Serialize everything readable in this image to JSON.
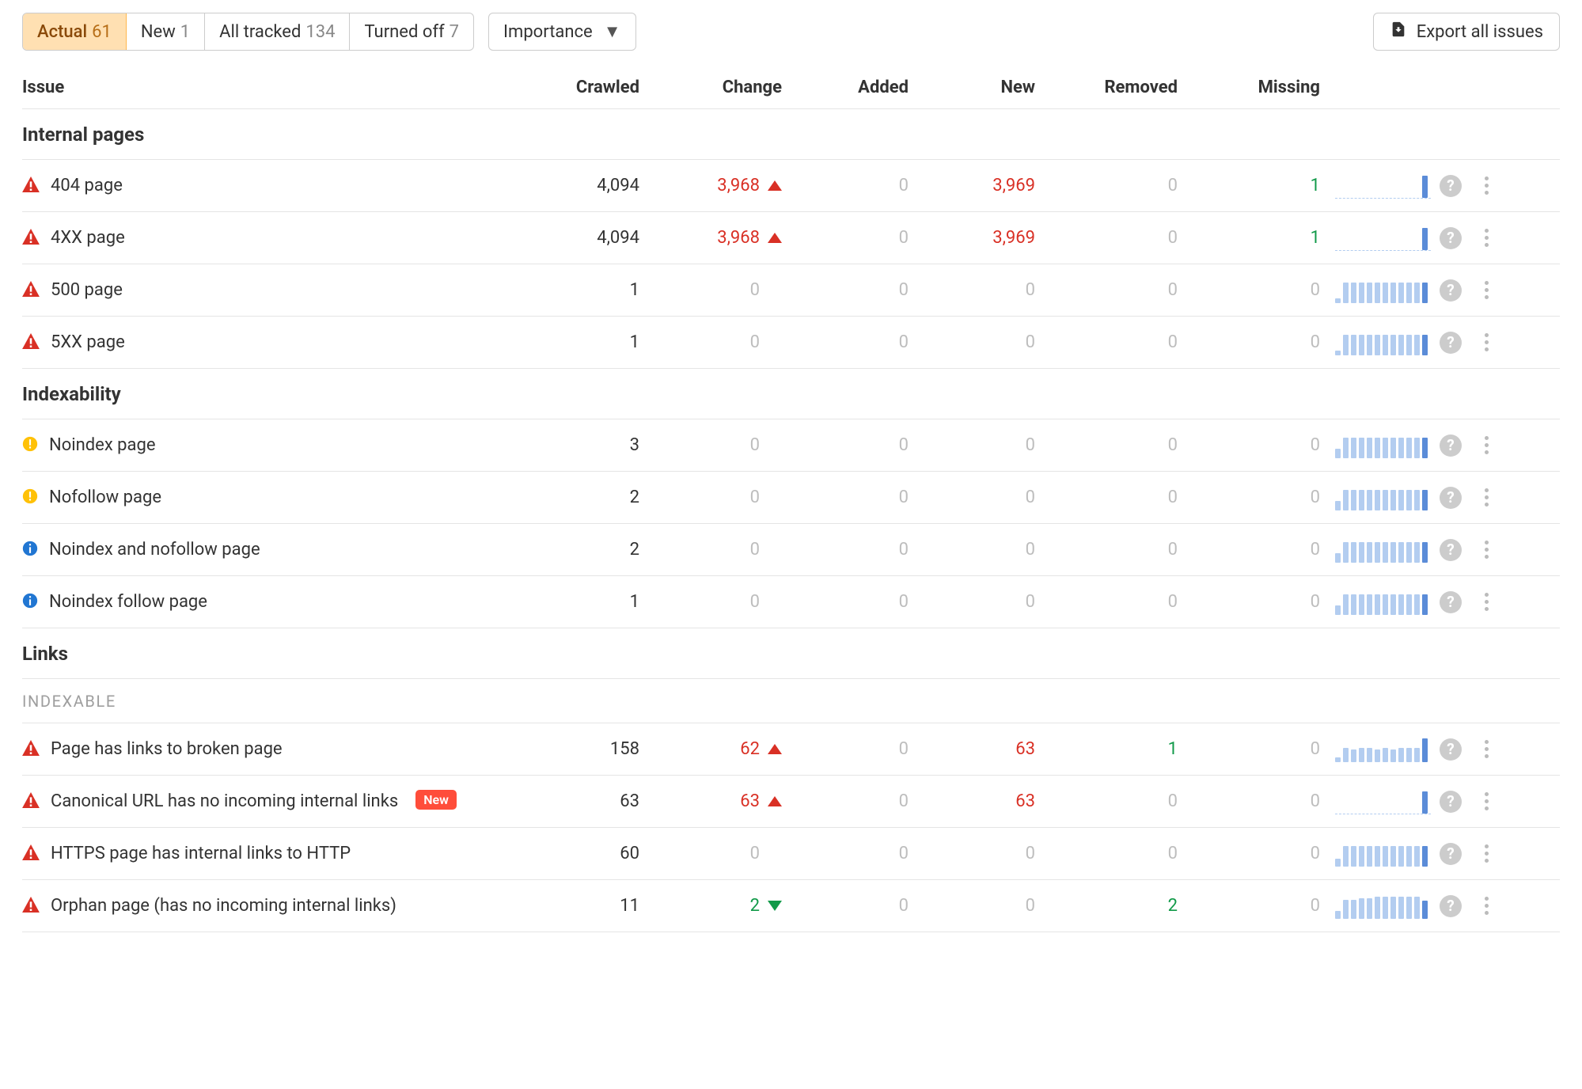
{
  "tabs": [
    {
      "label": "Actual",
      "count": "61",
      "active": true
    },
    {
      "label": "New",
      "count": "1",
      "active": false
    },
    {
      "label": "All tracked",
      "count": "134",
      "active": false
    },
    {
      "label": "Turned off",
      "count": "7",
      "active": false
    }
  ],
  "dropdown_label": "Importance",
  "export_label": "Export all issues",
  "columns": {
    "issue": "Issue",
    "crawled": "Crawled",
    "change": "Change",
    "added": "Added",
    "new": "New",
    "removed": "Removed",
    "missing": "Missing"
  },
  "sections": [
    {
      "title": "Internal pages",
      "rows": [
        {
          "sev": "error",
          "name": "404 page",
          "crawled": "4,094",
          "change_val": "3,968",
          "change_dir": "up",
          "added": "0",
          "added_muted": true,
          "new": "3,969",
          "new_color": "red",
          "removed": "0",
          "removed_muted": true,
          "missing": "1",
          "missing_color": "green",
          "bars": [
            0,
            0,
            0,
            0,
            0,
            0,
            0,
            0,
            0,
            0,
            0,
            28
          ],
          "dashed": true
        },
        {
          "sev": "error",
          "name": "4XX page",
          "crawled": "4,094",
          "change_val": "3,968",
          "change_dir": "up",
          "added": "0",
          "added_muted": true,
          "new": "3,969",
          "new_color": "red",
          "removed": "0",
          "removed_muted": true,
          "missing": "1",
          "missing_color": "green",
          "bars": [
            0,
            0,
            0,
            0,
            0,
            0,
            0,
            0,
            0,
            0,
            0,
            28
          ],
          "dashed": true
        },
        {
          "sev": "error",
          "name": "500 page",
          "crawled": "1",
          "change_val": "0",
          "change_dir": "none",
          "added": "0",
          "added_muted": true,
          "new": "0",
          "new_muted": true,
          "removed": "0",
          "removed_muted": true,
          "missing": "0",
          "missing_muted": true,
          "bars": [
            6,
            26,
            26,
            26,
            26,
            26,
            26,
            26,
            26,
            26,
            26,
            26
          ],
          "dashed": false
        },
        {
          "sev": "error",
          "name": "5XX page",
          "crawled": "1",
          "change_val": "0",
          "change_dir": "none",
          "added": "0",
          "added_muted": true,
          "new": "0",
          "new_muted": true,
          "removed": "0",
          "removed_muted": true,
          "missing": "0",
          "missing_muted": true,
          "bars": [
            6,
            26,
            26,
            26,
            26,
            26,
            26,
            26,
            26,
            26,
            26,
            26
          ],
          "dashed": false
        }
      ]
    },
    {
      "title": "Indexability",
      "rows": [
        {
          "sev": "warning",
          "name": "Noindex page",
          "crawled": "3",
          "change_val": "0",
          "change_dir": "none",
          "added": "0",
          "added_muted": true,
          "new": "0",
          "new_muted": true,
          "removed": "0",
          "removed_muted": true,
          "missing": "0",
          "missing_muted": true,
          "bars": [
            12,
            26,
            26,
            26,
            26,
            26,
            26,
            26,
            26,
            26,
            26,
            26
          ],
          "dashed": false
        },
        {
          "sev": "warning",
          "name": "Nofollow page",
          "crawled": "2",
          "change_val": "0",
          "change_dir": "none",
          "added": "0",
          "added_muted": true,
          "new": "0",
          "new_muted": true,
          "removed": "0",
          "removed_muted": true,
          "missing": "0",
          "missing_muted": true,
          "bars": [
            12,
            26,
            26,
            26,
            26,
            26,
            26,
            26,
            26,
            26,
            26,
            26
          ],
          "dashed": false
        },
        {
          "sev": "info",
          "name": "Noindex and nofollow page",
          "crawled": "2",
          "change_val": "0",
          "change_dir": "none",
          "added": "0",
          "added_muted": true,
          "new": "0",
          "new_muted": true,
          "removed": "0",
          "removed_muted": true,
          "missing": "0",
          "missing_muted": true,
          "bars": [
            12,
            26,
            26,
            26,
            26,
            26,
            26,
            26,
            26,
            26,
            26,
            26
          ],
          "dashed": false
        },
        {
          "sev": "info",
          "name": "Noindex follow page",
          "crawled": "1",
          "change_val": "0",
          "change_dir": "none",
          "added": "0",
          "added_muted": true,
          "new": "0",
          "new_muted": true,
          "removed": "0",
          "removed_muted": true,
          "missing": "0",
          "missing_muted": true,
          "bars": [
            12,
            26,
            26,
            26,
            26,
            26,
            26,
            26,
            26,
            26,
            26,
            26
          ],
          "dashed": false
        }
      ]
    },
    {
      "title": "Links",
      "subtitle": "Indexable",
      "rows": [
        {
          "sev": "error",
          "name": "Page has links to broken page",
          "crawled": "158",
          "change_val": "62",
          "change_dir": "up",
          "added": "0",
          "added_muted": true,
          "new": "63",
          "new_color": "red",
          "removed": "1",
          "removed_color": "green",
          "missing": "0",
          "missing_muted": true,
          "bars": [
            6,
            18,
            16,
            18,
            18,
            16,
            18,
            16,
            18,
            18,
            18,
            30
          ],
          "dashed": false
        },
        {
          "sev": "error",
          "name": "Canonical URL has no incoming internal links",
          "badge": "New",
          "crawled": "63",
          "change_val": "63",
          "change_dir": "up",
          "added": "0",
          "added_muted": true,
          "new": "63",
          "new_color": "red",
          "removed": "0",
          "removed_muted": true,
          "missing": "0",
          "missing_muted": true,
          "bars": [
            0,
            0,
            0,
            0,
            0,
            0,
            0,
            0,
            0,
            0,
            0,
            28
          ],
          "dashed": true
        },
        {
          "sev": "error",
          "name": "HTTPS page has internal links to HTTP",
          "crawled": "60",
          "change_val": "0",
          "change_dir": "none",
          "added": "0",
          "added_muted": true,
          "new": "0",
          "new_muted": true,
          "removed": "0",
          "removed_muted": true,
          "missing": "0",
          "missing_muted": true,
          "bars": [
            10,
            26,
            26,
            26,
            26,
            26,
            26,
            26,
            26,
            26,
            26,
            26
          ],
          "dashed": false
        },
        {
          "sev": "error",
          "name": "Orphan page (has no incoming internal links)",
          "crawled": "11",
          "change_val": "2",
          "change_dir": "down",
          "added": "0",
          "added_muted": true,
          "new": "0",
          "new_muted": true,
          "removed": "2",
          "removed_color": "green",
          "missing": "0",
          "missing_muted": true,
          "bars": [
            10,
            24,
            24,
            26,
            26,
            28,
            28,
            28,
            28,
            28,
            28,
            23
          ],
          "dashed": false
        }
      ]
    }
  ],
  "chart_data": {
    "type": "table",
    "title": "Site Audit — All Issues",
    "columns": [
      "Issue",
      "Crawled",
      "Change",
      "Added",
      "New",
      "Removed",
      "Missing"
    ],
    "groups": [
      {
        "name": "Internal pages",
        "rows": [
          {
            "issue": "404 page",
            "crawled": 4094,
            "change": 3968,
            "added": 0,
            "new": 3969,
            "removed": 0,
            "missing": 1
          },
          {
            "issue": "4XX page",
            "crawled": 4094,
            "change": 3968,
            "added": 0,
            "new": 3969,
            "removed": 0,
            "missing": 1
          },
          {
            "issue": "500 page",
            "crawled": 1,
            "change": 0,
            "added": 0,
            "new": 0,
            "removed": 0,
            "missing": 0
          },
          {
            "issue": "5XX page",
            "crawled": 1,
            "change": 0,
            "added": 0,
            "new": 0,
            "removed": 0,
            "missing": 0
          }
        ]
      },
      {
        "name": "Indexability",
        "rows": [
          {
            "issue": "Noindex page",
            "crawled": 3,
            "change": 0,
            "added": 0,
            "new": 0,
            "removed": 0,
            "missing": 0
          },
          {
            "issue": "Nofollow page",
            "crawled": 2,
            "change": 0,
            "added": 0,
            "new": 0,
            "removed": 0,
            "missing": 0
          },
          {
            "issue": "Noindex and nofollow page",
            "crawled": 2,
            "change": 0,
            "added": 0,
            "new": 0,
            "removed": 0,
            "missing": 0
          },
          {
            "issue": "Noindex follow page",
            "crawled": 1,
            "change": 0,
            "added": 0,
            "new": 0,
            "removed": 0,
            "missing": 0
          }
        ]
      },
      {
        "name": "Links / Indexable",
        "rows": [
          {
            "issue": "Page has links to broken page",
            "crawled": 158,
            "change": 62,
            "added": 0,
            "new": 63,
            "removed": 1,
            "missing": 0
          },
          {
            "issue": "Canonical URL has no incoming internal links",
            "crawled": 63,
            "change": 63,
            "added": 0,
            "new": 63,
            "removed": 0,
            "missing": 0
          },
          {
            "issue": "HTTPS page has internal links to HTTP",
            "crawled": 60,
            "change": 0,
            "added": 0,
            "new": 0,
            "removed": 0,
            "missing": 0
          },
          {
            "issue": "Orphan page (has no incoming internal links)",
            "crawled": 11,
            "change": -2,
            "added": 0,
            "new": 0,
            "removed": 2,
            "missing": 0
          }
        ]
      }
    ]
  }
}
